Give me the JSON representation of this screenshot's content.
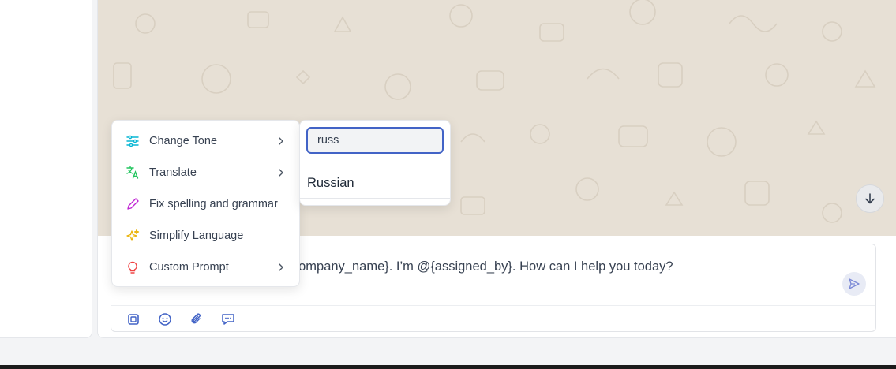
{
  "composer": {
    "message": "Hi, thanks for contacting @{company_name}. I’m @{assigned_by}. How can I help you today?"
  },
  "toolbar": {
    "icons": [
      "ai-chip-icon",
      "emoji-icon",
      "paperclip-icon",
      "canned-response-icon"
    ]
  },
  "ai_menu": {
    "items": [
      {
        "label": "Change Tone",
        "icon": "sliders-icon",
        "submenu": true,
        "color": "#06b6d4"
      },
      {
        "label": "Translate",
        "icon": "translate-icon",
        "submenu": true,
        "color": "#22c55e"
      },
      {
        "label": "Fix spelling and grammar",
        "icon": "pencil-icon",
        "submenu": false,
        "color": "#c026d3"
      },
      {
        "label": "Simplify Language",
        "icon": "sparkles-icon",
        "submenu": false,
        "color": "#eab308"
      },
      {
        "label": "Custom Prompt",
        "icon": "lightbulb-icon",
        "submenu": true,
        "color": "#ef4444"
      }
    ]
  },
  "language_popup": {
    "search_value": "russ",
    "options": [
      "Russian"
    ]
  },
  "colors": {
    "accent": "#4263c6",
    "chat_background": "#e7e0d5"
  }
}
